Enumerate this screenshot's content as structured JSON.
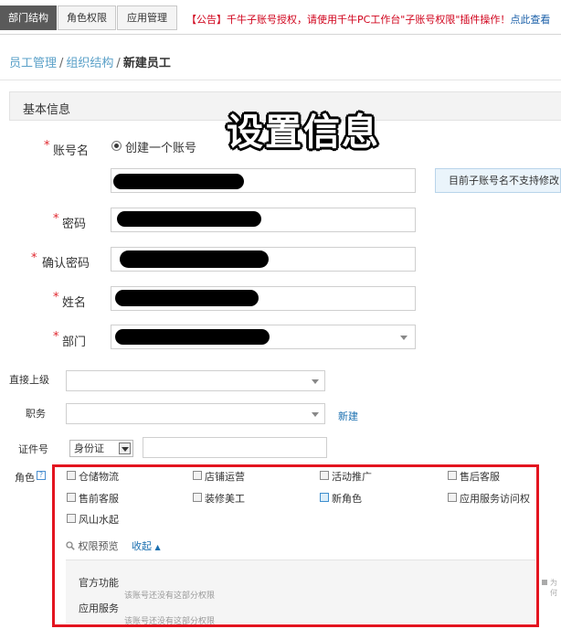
{
  "tabs": [
    {
      "label": "部门结构",
      "active": true
    },
    {
      "label": "角色权限",
      "active": false
    },
    {
      "label": "应用管理",
      "active": false
    }
  ],
  "notice": {
    "text": "【公告】千牛子账号授权，请使用千牛PC工作台\"子账号权限\"插件操作！",
    "link": "点此查看"
  },
  "breadcrumb": {
    "items": [
      "员工管理",
      "组织结构"
    ],
    "separator": "/",
    "current": "新建员工"
  },
  "section": {
    "title": "基本信息"
  },
  "overlay_text": "设置信息",
  "form": {
    "account": {
      "label": "账号名",
      "radio_label": "创建一个账号",
      "tip": "目前子账号名不支持修改，"
    },
    "password": {
      "label": "密码"
    },
    "confirm": {
      "label": "确认密码"
    },
    "name": {
      "label": "姓名"
    },
    "dept": {
      "label": "部门"
    },
    "superior": {
      "label": "直接上级"
    },
    "position": {
      "label": "职务",
      "new_link": "新建"
    },
    "id": {
      "label": "证件号",
      "type": "身份证"
    }
  },
  "roles": {
    "label": "角色",
    "help_icon": "?",
    "items": [
      {
        "label": "仓储物流",
        "checked": false
      },
      {
        "label": "店铺运营",
        "checked": false
      },
      {
        "label": "活动推广",
        "checked": false
      },
      {
        "label": "售后客服",
        "checked": false
      },
      {
        "label": "售前客服",
        "checked": false
      },
      {
        "label": "装修美工",
        "checked": false
      },
      {
        "label": "新角色",
        "checked": false
      },
      {
        "label": "应用服务访问权",
        "checked": false
      },
      {
        "label": "风山水起",
        "checked": false
      }
    ],
    "preview_label": "权限预览",
    "collapse_label": "收起",
    "permissions": [
      {
        "name": "官方功能",
        "note": "该账号还没有这部分权限"
      },
      {
        "name": "应用服务",
        "note": "该账号还没有这部分权限"
      }
    ],
    "side_text": "为何"
  }
}
